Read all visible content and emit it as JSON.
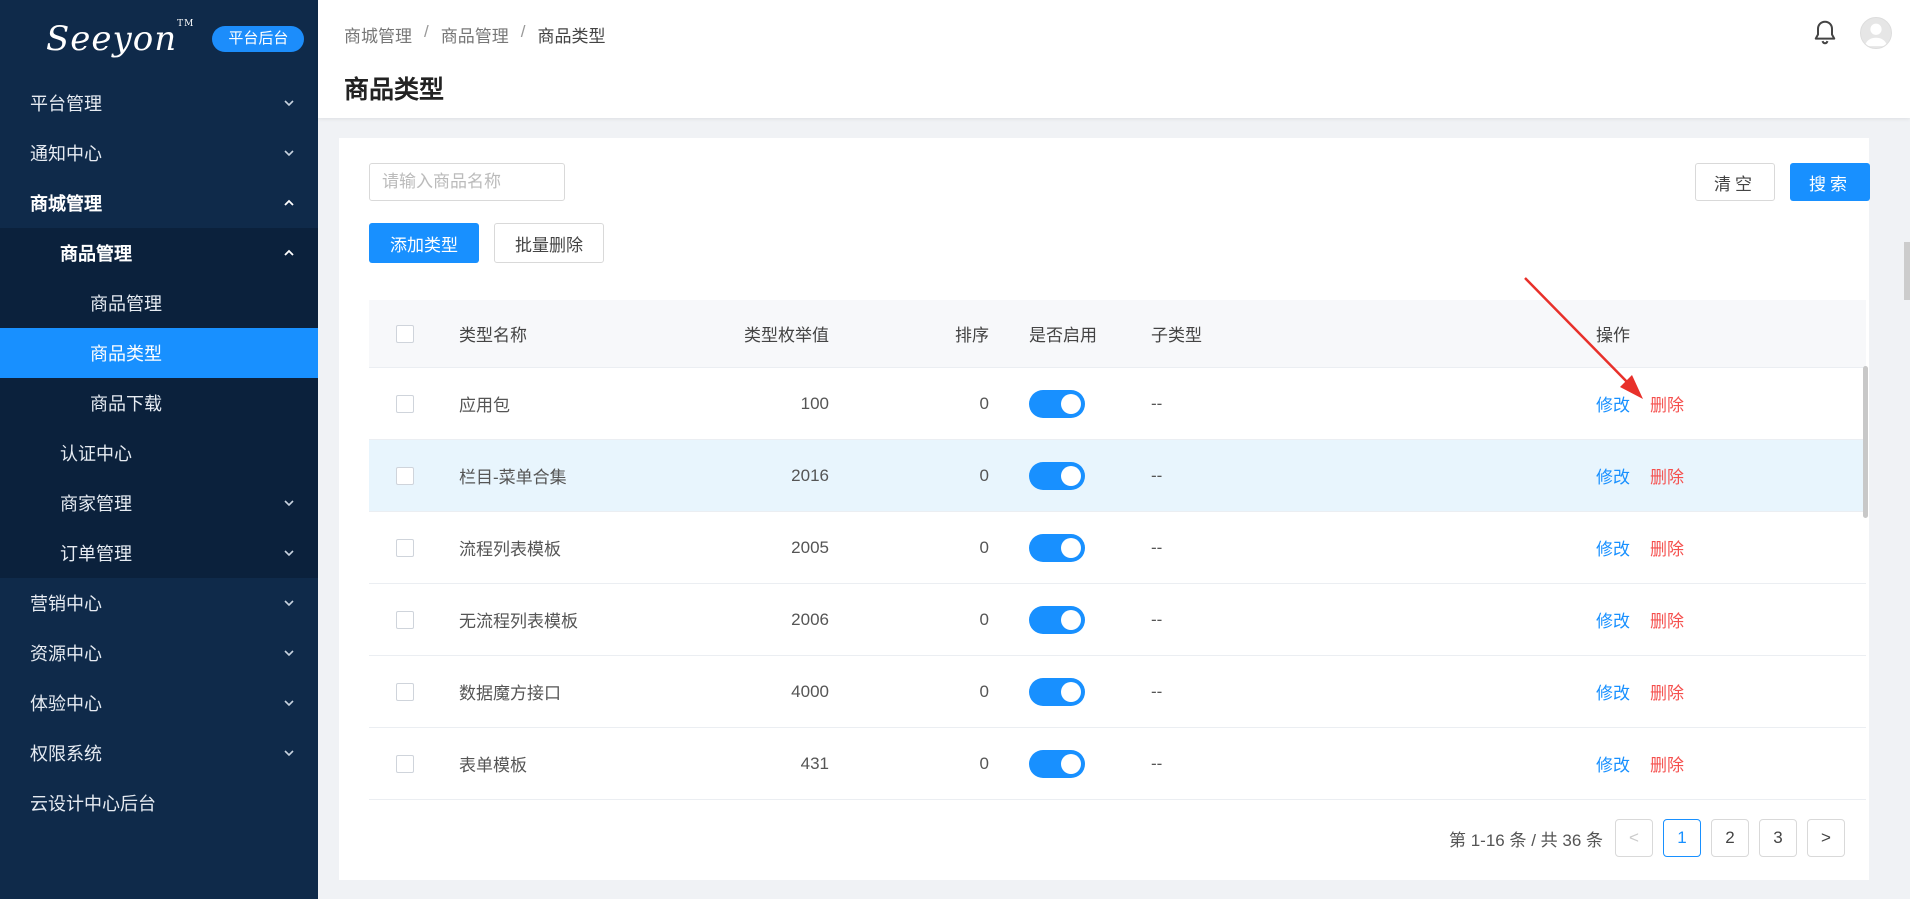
{
  "logo": {
    "text": "Seeyon",
    "tm": "TM",
    "badge": "平台后台"
  },
  "sidebar": {
    "items": [
      {
        "label": "平台管理",
        "level": 1,
        "chevron": "down"
      },
      {
        "label": "通知中心",
        "level": 1,
        "chevron": "down"
      },
      {
        "label": "商城管理",
        "level": 1,
        "chevron": "up",
        "bold": true
      },
      {
        "label": "商品管理",
        "level": 2,
        "chevron": "up",
        "bold": true
      },
      {
        "label": "商品管理",
        "level": 3,
        "chevron": ""
      },
      {
        "label": "商品类型",
        "level": 3,
        "chevron": "",
        "active": true
      },
      {
        "label": "商品下载",
        "level": 3,
        "chevron": ""
      },
      {
        "label": "认证中心",
        "level": 2,
        "chevron": ""
      },
      {
        "label": "商家管理",
        "level": 2,
        "chevron": "down"
      },
      {
        "label": "订单管理",
        "level": 2,
        "chevron": "down"
      },
      {
        "label": "营销中心",
        "level": 1,
        "chevron": "down"
      },
      {
        "label": "资源中心",
        "level": 1,
        "chevron": "down"
      },
      {
        "label": "体验中心",
        "level": 1,
        "chevron": "down"
      },
      {
        "label": "权限系统",
        "level": 1,
        "chevron": "down"
      },
      {
        "label": "云设计中心后台",
        "level": 1,
        "chevron": ""
      }
    ]
  },
  "header": {
    "breadcrumb": [
      "商城管理",
      "商品管理",
      "商品类型"
    ],
    "title": "商品类型",
    "icons": [
      "bell-icon",
      "avatar-icon"
    ]
  },
  "toolbar": {
    "search_placeholder": "请输入商品名称",
    "search_value": "",
    "clear_label": "清空",
    "search_label": "搜索",
    "add_label": "添加类型",
    "batch_delete_label": "批量删除"
  },
  "table": {
    "columns": [
      "类型名称",
      "类型枚举值",
      "排序",
      "是否启用",
      "子类型",
      "操作"
    ],
    "rows": [
      {
        "name": "应用包",
        "enum": "100",
        "sort": "0",
        "enabled": true,
        "sub": "--",
        "edit": "修改",
        "del": "删除"
      },
      {
        "name": "栏目-菜单合集",
        "enum": "2016",
        "sort": "0",
        "enabled": true,
        "sub": "--",
        "edit": "修改",
        "del": "删除",
        "highlight": true
      },
      {
        "name": "流程列表模板",
        "enum": "2005",
        "sort": "0",
        "enabled": true,
        "sub": "--",
        "edit": "修改",
        "del": "删除"
      },
      {
        "name": "无流程列表模板",
        "enum": "2006",
        "sort": "0",
        "enabled": true,
        "sub": "--",
        "edit": "修改",
        "del": "删除"
      },
      {
        "name": "数据魔方接口",
        "enum": "4000",
        "sort": "0",
        "enabled": true,
        "sub": "--",
        "edit": "修改",
        "del": "删除"
      },
      {
        "name": "表单模板",
        "enum": "431",
        "sort": "0",
        "enabled": true,
        "sub": "--",
        "edit": "修改",
        "del": "删除"
      }
    ]
  },
  "pagination": {
    "total_text": "第 1-16 条 / 共 36 条",
    "pages": [
      "1",
      "2",
      "3"
    ],
    "current": "1",
    "prev": "<",
    "next": ">"
  },
  "colors": {
    "sidebar_bg": "#0f2a4a",
    "accent": "#1890ff",
    "danger": "#f5504e",
    "annotation_arrow": "#e8302a"
  }
}
